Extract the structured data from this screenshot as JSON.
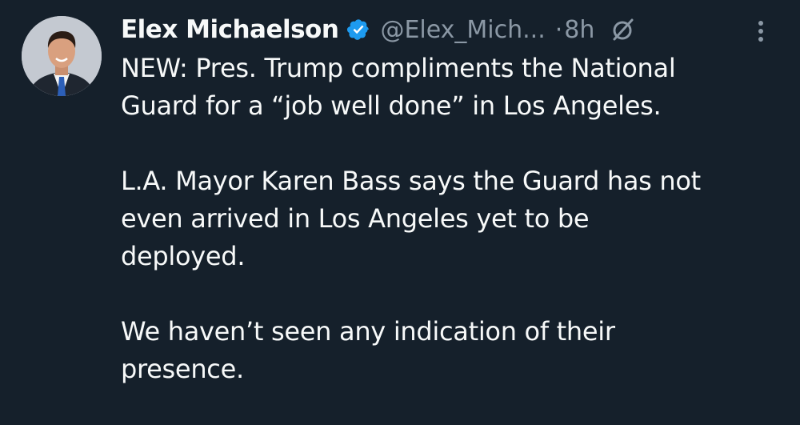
{
  "tweet": {
    "author": {
      "display_name": "Elex Michaelson",
      "handle": "@Elex_Mich...",
      "verified": true
    },
    "separator": "·",
    "time": "8h",
    "paragraphs": [
      "NEW: Pres. Trump compliments the National\nGuard for a “job well done” in Los Angeles.",
      "L.A. Mayor Karen Bass says the Guard has not\neven arrived in Los Angeles yet to be\ndeployed.",
      "We haven’t seen any indication of their\npresence."
    ]
  },
  "icons": {
    "verified": "verified-badge-icon",
    "grok": "grok-icon",
    "more": "more-options-icon"
  },
  "colors": {
    "background": "#15202b",
    "text": "#f7f9f9",
    "muted": "#8b98a5",
    "verified": "#1d9bf0"
  }
}
